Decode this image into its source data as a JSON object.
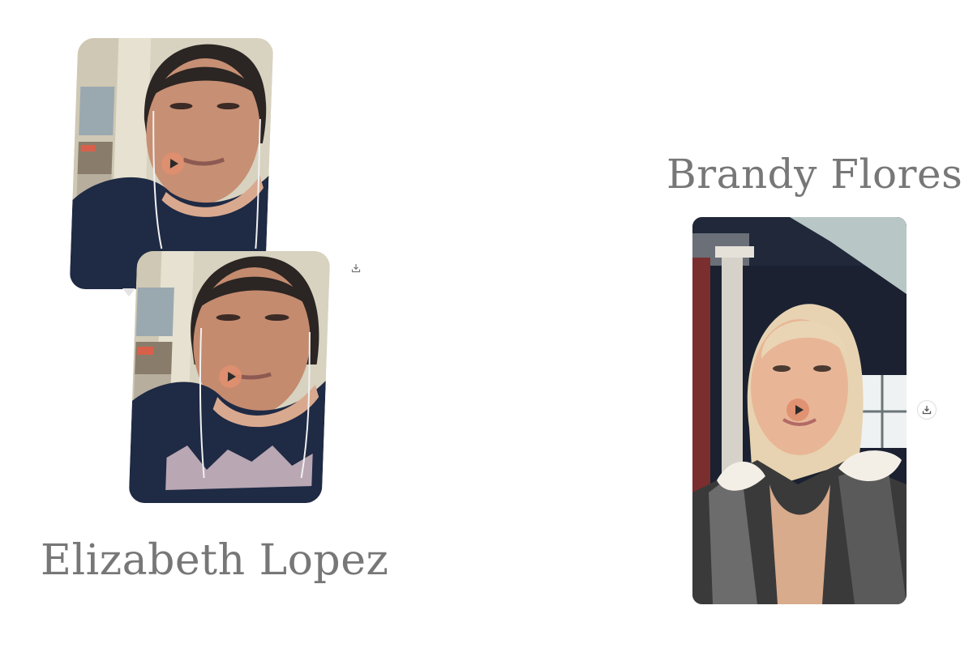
{
  "testimonials": [
    {
      "name": "Brandy Flores",
      "clip_count": 1,
      "play_icon": "play-icon",
      "download_icon": "download-icon"
    },
    {
      "name": "Elizabeth Lopez",
      "clip_count": 2,
      "play_icon": "play-icon",
      "download_icon": "download-icon"
    }
  ],
  "colors": {
    "background": "#ffffff",
    "name_text": "#777777",
    "play_button": "#de8f6f",
    "shirt": "#1f2a44",
    "hair_blonde": "#e7d3b1"
  }
}
